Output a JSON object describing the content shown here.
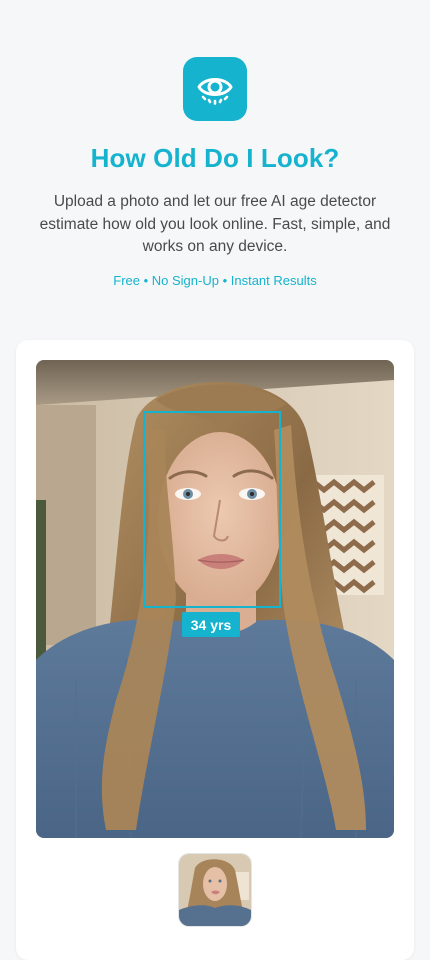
{
  "header": {
    "icon": "eye-icon",
    "title": "How Old Do I Look?",
    "description": "Upload a photo and let our free AI age detector estimate how old you look online. Fast, simple, and works on any device.",
    "features": "Free • No Sign-Up • Instant Results"
  },
  "result": {
    "age_label": "34 yrs"
  },
  "colors": {
    "accent": "#16b3cf",
    "background": "#f6f7f8",
    "card": "#ffffff"
  }
}
